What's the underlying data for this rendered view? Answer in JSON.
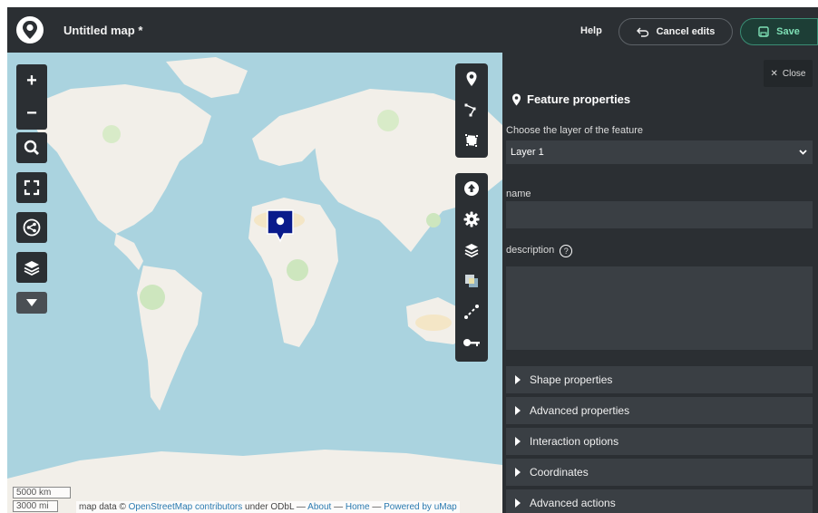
{
  "header": {
    "title": "Untitled map *",
    "help_label": "Help",
    "cancel_label": "Cancel edits",
    "save_label": "Save"
  },
  "map": {
    "left_controls": [
      "zoom-in",
      "zoom-out",
      "search",
      "fullscreen",
      "share",
      "layers",
      "more"
    ],
    "zoom_in_label": "+",
    "zoom_out_label": "−",
    "edit_tools": [
      "draw-marker",
      "draw-polyline",
      "draw-polygon"
    ],
    "settings_tools": [
      "import-data",
      "map-settings",
      "manage-layers",
      "change-tilelayer",
      "change-map-extent",
      "map-permissions"
    ],
    "scale_metric": "5000 km",
    "scale_imperial": "3000 mi",
    "attribution": {
      "prefix": "map data ©",
      "osm_link": "OpenStreetMap contributors",
      "under": "under ODbL",
      "about_link": "About",
      "home_link": "Home",
      "powered_link": "Powered by uMap",
      "separator": "—"
    }
  },
  "panel": {
    "close_label": "Close",
    "title": "Feature properties",
    "layer_label": "Choose the layer of the feature",
    "layer_value": "Layer 1",
    "name_label": "name",
    "name_value": "",
    "description_label": "description",
    "description_value": "",
    "help_glyph": "?",
    "sections": [
      "Shape properties",
      "Advanced properties",
      "Interaction options",
      "Coordinates",
      "Advanced actions"
    ]
  },
  "colors": {
    "dark_bg": "#2b2f33",
    "field_bg": "#3a3f44",
    "marker": "#0a1b8c",
    "save_accent": "#7fe0b6",
    "sea": "#aad3df",
    "land": "#f2efe9"
  }
}
